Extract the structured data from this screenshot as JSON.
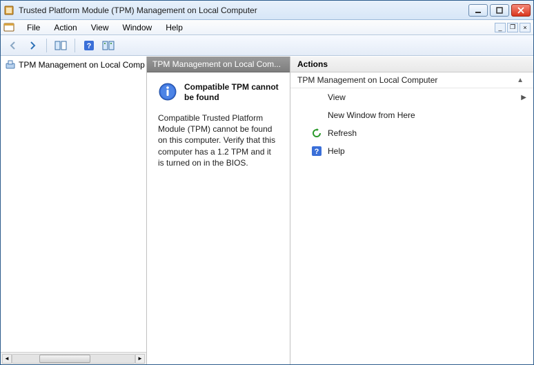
{
  "window": {
    "title": "Trusted Platform Module (TPM) Management on Local Computer"
  },
  "menu": {
    "file": "File",
    "action": "Action",
    "view": "View",
    "window": "Window",
    "help": "Help"
  },
  "tree": {
    "root": "TPM Management on Local Comp"
  },
  "mid": {
    "header": "TPM Management on Local Com...",
    "info_heading": "Compatible TPM cannot be found",
    "info_body": "Compatible Trusted Platform Module (TPM) cannot be found on this computer. Verify that this computer has a 1.2 TPM and it is turned on in the BIOS."
  },
  "actions": {
    "header": "Actions",
    "group_title": "TPM Management on Local Computer",
    "view": "View",
    "new_window": "New Window from Here",
    "refresh": "Refresh",
    "help": "Help"
  }
}
